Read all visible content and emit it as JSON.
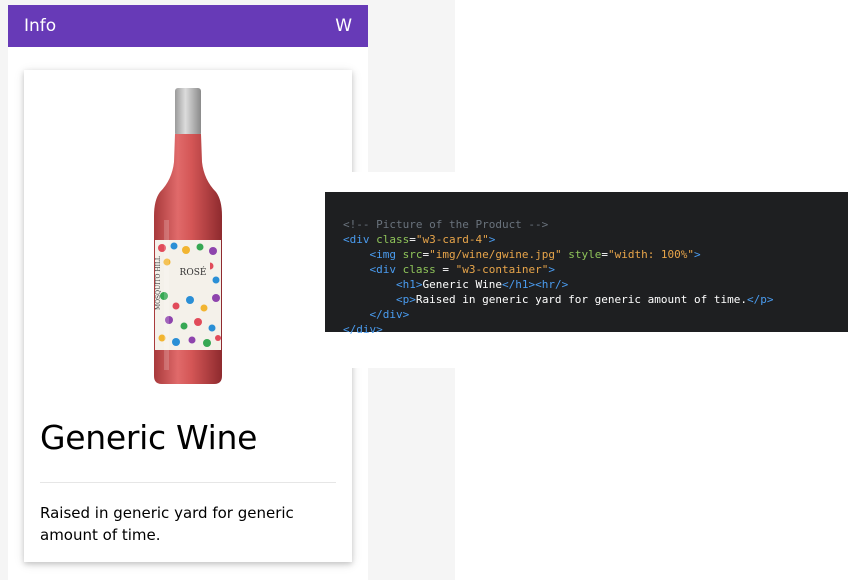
{
  "colors": {
    "topbar": "#673ab7",
    "code_background": "#1e1f21"
  },
  "topbar": {
    "title": "Info",
    "right_label": "W"
  },
  "card": {
    "image_icon": "wine-bottle-icon",
    "bottle_label": "ROSÉ",
    "bottle_brand": "MOSQUITO HILL",
    "heading": "Generic Wine",
    "description": "Raised in generic yard for generic amount of time."
  },
  "code": {
    "line1": "<!-- Picture of the Product -->",
    "line2_open": "<div ",
    "line2_attr": "class",
    "line2_eq": "=",
    "line2_val": "\"w3-card-4\"",
    "line2_close": ">",
    "line3_open": "<img ",
    "line3_attr1": "src",
    "line3_eq1": "=",
    "line3_val1": "\"img/wine/gwine.jpg\"",
    "line3_attr2": "style",
    "line3_eq2": "=",
    "line3_val2": "\"width: 100%\"",
    "line3_close": ">",
    "line4_open": "<div ",
    "line4_attr": "class",
    "line4_eq": " = ",
    "line4_val": "\"w3-container\"",
    "line4_close": ">",
    "line5_open": "<h1>",
    "line5_text": "Generic Wine",
    "line5_close": "</h1><hr/>",
    "line6_open": "<p>",
    "line6_text": "Raised in generic yard for generic amount of time.",
    "line6_close": "</p>",
    "line7": "</div>",
    "line8": "</div>"
  }
}
